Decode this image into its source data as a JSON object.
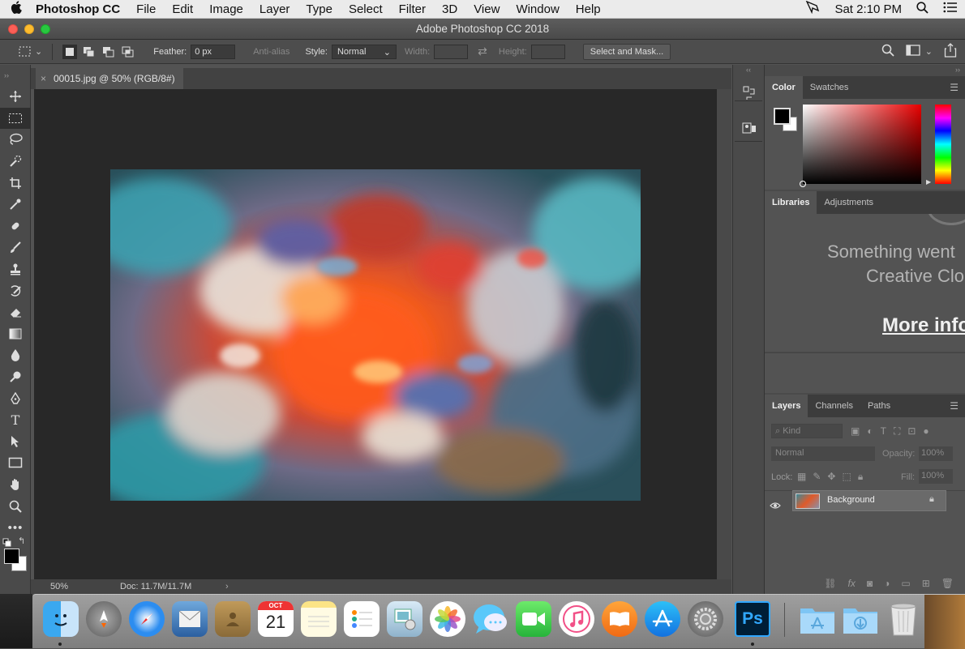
{
  "menubar": {
    "apple": "",
    "app_name": "Photoshop CC",
    "items": [
      "File",
      "Edit",
      "Image",
      "Layer",
      "Type",
      "Select",
      "Filter",
      "3D",
      "View",
      "Window",
      "Help"
    ],
    "clock": "Sat 2:10 PM"
  },
  "window": {
    "title": "Adobe Photoshop CC 2018"
  },
  "options": {
    "feather_label": "Feather:",
    "feather_value": "0 px",
    "antialias_label": "Anti-alias",
    "style_label": "Style:",
    "style_value": "Normal",
    "width_label": "Width:",
    "height_label": "Height:",
    "select_mask_label": "Select and Mask..."
  },
  "document": {
    "tab_title": "00015.jpg @ 50% (RGB/8#)",
    "zoom": "50%",
    "doc_info": "Doc: 11.7M/11.7M"
  },
  "tools": [
    "move-tool-icon",
    "marquee-tool-icon",
    "lasso-tool-icon",
    "quick-select-tool-icon",
    "crop-tool-icon",
    "eyedropper-tool-icon",
    "healing-brush-tool-icon",
    "brush-tool-icon",
    "clone-stamp-tool-icon",
    "history-brush-tool-icon",
    "eraser-tool-icon",
    "gradient-tool-icon",
    "blur-tool-icon",
    "dodge-tool-icon",
    "pen-tool-icon",
    "type-tool-icon",
    "path-select-tool-icon",
    "rectangle-tool-icon",
    "hand-tool-icon",
    "zoom-tool-icon",
    "more-tools-icon"
  ],
  "color_panel": {
    "tab1": "Color",
    "tab2": "Swatches",
    "foreground": "#000000",
    "background": "#ffffff"
  },
  "libraries_panel": {
    "tab1": "Libraries",
    "tab2": "Adjustments",
    "message_line1": "Something went",
    "message_line2": "Creative Clo",
    "more_info": "More info"
  },
  "layers_panel": {
    "tab1": "Layers",
    "tab2": "Channels",
    "tab3": "Paths",
    "kind_label": "Kind",
    "blend_mode": "Normal",
    "opacity_label": "Opacity:",
    "opacity_value": "100%",
    "lock_label": "Lock:",
    "fill_label": "Fill:",
    "fill_value": "100%",
    "layer_name": "Background"
  },
  "dock": {
    "calendar_month": "OCT",
    "calendar_day": "21",
    "ps_label": "Ps",
    "apps": [
      "finder-icon",
      "launchpad-icon",
      "safari-icon",
      "mail-icon",
      "contacts-icon",
      "calendar-icon",
      "notes-icon",
      "reminders-icon",
      "preview-icon",
      "photos-icon",
      "messages-icon",
      "facetime-icon",
      "itunes-icon",
      "ibooks-icon",
      "app-store-icon",
      "system-preferences-icon",
      "photoshop-icon",
      "applications-folder-icon",
      "downloads-folder-icon",
      "trash-icon"
    ]
  },
  "colors": {
    "accent": "#0f7fd0",
    "ps_blue": "#31a8ff",
    "ps_bg": "#001e36"
  }
}
